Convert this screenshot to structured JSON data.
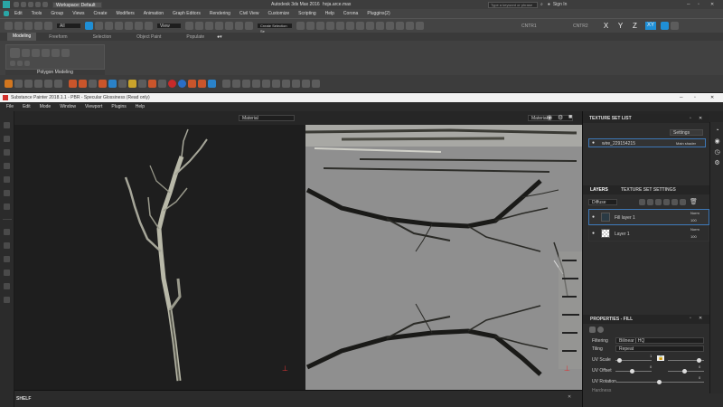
{
  "max": {
    "title": "Autodesk 3ds Max 2016",
    "filename": "hoja.arce.max",
    "workspace": "Workspace: Default",
    "search_placeholder": "Type a keyword or phrase",
    "sign_in": "Sign In",
    "menu": [
      "Edit",
      "Tools",
      "Group",
      "Views",
      "Create",
      "Modifiers",
      "Animation",
      "Graph Editors",
      "Rendering",
      "Civil View",
      "Customize",
      "Scripting",
      "Help",
      "Corona",
      "Pluggins(2)"
    ],
    "selection_filter": "All",
    "view_dropdown": "View",
    "create_selection_set": "Create Selection Se",
    "ribbon_tabs": [
      "Modeling",
      "Freeform",
      "Selection",
      "Object Paint",
      "Populate"
    ],
    "ribbon_panel": "Polygon Modeling",
    "cntr1": "CNTR1",
    "cntr2": "CNTR2",
    "axes": [
      "X",
      "Y",
      "Z",
      "XY"
    ],
    "colors": {
      "accent": "#1f8fd6"
    }
  },
  "sp": {
    "title": "Substance Painter 2018.1.1 - PBR - Specular Glossiness (Read only)",
    "menu": [
      "File",
      "Edit",
      "Mode",
      "Window",
      "Viewport",
      "Plugins",
      "Help"
    ],
    "vp3d_dropdown": "Material",
    "vp2d_dropdown": "Material",
    "shelf": "SHELF",
    "texture_set_list": {
      "title": "TEXTURE SET LIST",
      "settings": "Settings",
      "set_name": "wire_229154215",
      "shader": "Main shader"
    },
    "tabs": {
      "layers": "LAYERS",
      "settings": "TEXTURE SET SETTINGS"
    },
    "channel": "Diffuse",
    "layers": [
      {
        "name": "Fill layer 1",
        "blend": "Norm",
        "opacity": "100",
        "selected": true
      },
      {
        "name": "Layer 1",
        "blend": "Norm",
        "opacity": "100",
        "selected": false
      }
    ],
    "properties": {
      "title": "PROPERTIES - FILL",
      "filtering_label": "Filtering",
      "filtering_value": "Bilinear | HQ",
      "tiling_label": "Tiling",
      "tiling_value": "Repeat",
      "uv_scale": "UV Scale",
      "uv_scale_value": "1",
      "uv_offset": "UV Offset",
      "uv_offset_value": "0",
      "uv_offset_value2": "0",
      "uv_rotation": "UV Rotation",
      "uv_rotation_value": "0",
      "hardness": "Hardness"
    }
  }
}
